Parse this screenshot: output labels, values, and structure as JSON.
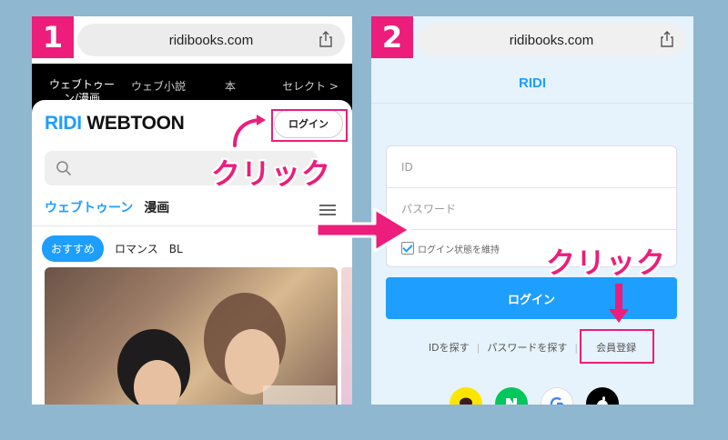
{
  "colors": {
    "accent": "#ec1d7b",
    "brand": "#1e9eff",
    "background": "#8fb7cf"
  },
  "panel1": {
    "step": "1",
    "url": "ridibooks.com",
    "topnav": [
      "ウェブトゥーン/漫画",
      "ウェブ小説",
      "本",
      "セレクト >"
    ],
    "logo_a": "RIDI",
    "logo_b": " WEBTOON",
    "login_label": "ログイン",
    "callout": "クリック",
    "tab_a": "ウェブトゥーン",
    "tab_b": "漫画",
    "chips": [
      "おすすめ",
      "ロマンス",
      "BL"
    ]
  },
  "panel2": {
    "step": "2",
    "url": "ridibooks.com",
    "header": "RIDI",
    "id_placeholder": "ID",
    "password_placeholder": "パスワード",
    "keep_login": "ログイン状態を維持",
    "login_label": "ログイン",
    "callout": "クリック",
    "links": [
      "IDを探す",
      "パスワードを探す",
      "会員登録"
    ],
    "social_icons": [
      "kakao-icon",
      "naver-icon",
      "google-icon",
      "apple-icon"
    ]
  }
}
